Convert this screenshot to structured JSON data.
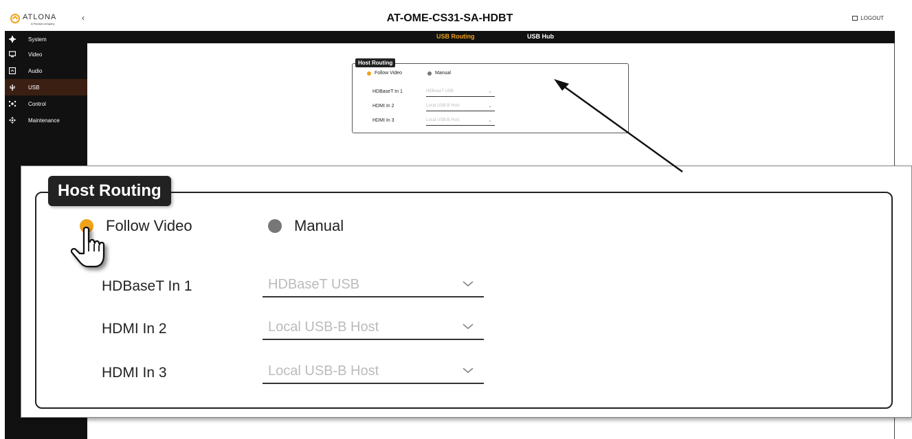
{
  "brand": {
    "name": "ATLONA",
    "sub": "A Panduit company"
  },
  "header": {
    "title": "AT-OME-CS31-SA-HDBT",
    "logout": "LOGOUT",
    "collapse": "‹"
  },
  "tabs": [
    {
      "label": "USB Routing",
      "active": true
    },
    {
      "label": "USB Hub",
      "active": false
    }
  ],
  "sidebar": {
    "items": [
      {
        "label": "System",
        "icon": "gear-icon",
        "active": false
      },
      {
        "label": "Video",
        "icon": "monitor-icon",
        "active": false
      },
      {
        "label": "Audio",
        "icon": "audio-icon",
        "active": false
      },
      {
        "label": "USB",
        "icon": "usb-icon",
        "active": true
      },
      {
        "label": "Control",
        "icon": "control-icon",
        "active": false
      },
      {
        "label": "Maintenance",
        "icon": "maintenance-icon",
        "active": false
      }
    ]
  },
  "host_routing": {
    "title": "Host Routing",
    "mode_options": [
      {
        "label": "Follow Video",
        "selected": true
      },
      {
        "label": "Manual",
        "selected": false
      }
    ],
    "rows": [
      {
        "label": "HDBaseT In 1",
        "value": "HDBaseT USB"
      },
      {
        "label": "HDMI In 2",
        "value": "Local USB-B Host"
      },
      {
        "label": "HDMI In 3",
        "value": "Local USB-B Host"
      }
    ]
  },
  "colors": {
    "accent": "#f0a21a",
    "sidebar_bg": "#111111",
    "active_item_bg": "#3a1f12",
    "radio_off": "#777777"
  }
}
